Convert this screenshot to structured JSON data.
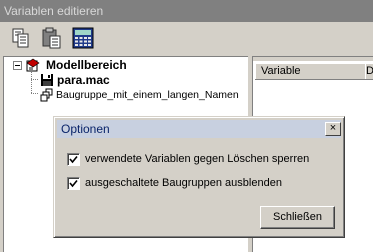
{
  "window": {
    "title": "Variablen editieren"
  },
  "toolbar": {
    "buttons": [
      {
        "icon": "copy-icon"
      },
      {
        "icon": "paste-icon"
      },
      {
        "icon": "calculator-icon"
      }
    ]
  },
  "tree": {
    "root": {
      "label": "Modellbereich",
      "expanded": true
    },
    "children": [
      {
        "label": "para.mac",
        "icon": "floppy-disk-icon"
      },
      {
        "label": "Baugruppe_mit_einem_langen_Namen",
        "icon": "assembly-icon"
      }
    ]
  },
  "variables_table": {
    "columns": [
      "Variable",
      "De"
    ]
  },
  "dialog": {
    "title": "Optionen",
    "close_label": "×",
    "options": [
      {
        "label": "verwendete Variablen gegen Löschen sperren",
        "checked": true
      },
      {
        "label": "ausgeschaltete Baugruppen ausblenden",
        "checked": true
      }
    ],
    "close_button_label": "Schließen"
  }
}
